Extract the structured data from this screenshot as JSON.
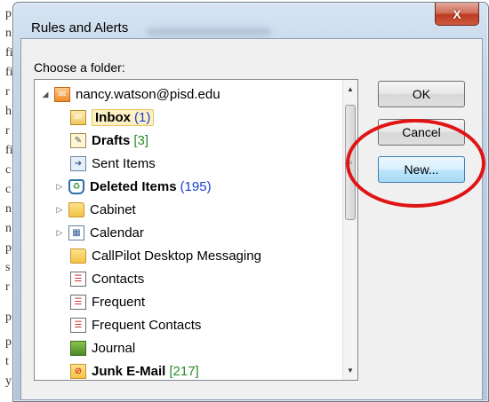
{
  "dialog": {
    "title": "Rules and Alerts",
    "close_label": "X",
    "choose_label": "Choose a folder:"
  },
  "tree": {
    "items": [
      {
        "label": "nancy.watson@pisd.edu",
        "count": "",
        "icon": "mailbox-icon",
        "expander": "◢",
        "bold": false
      },
      {
        "label": "Inbox",
        "count": "(1)",
        "icon": "inbox-icon",
        "expander": "",
        "bold": true
      },
      {
        "label": "Drafts",
        "count": "[3]",
        "icon": "drafts-icon",
        "expander": "",
        "bold": true
      },
      {
        "label": "Sent Items",
        "count": "",
        "icon": "sent-items-icon",
        "expander": "",
        "bold": false
      },
      {
        "label": "Deleted Items",
        "count": "(195)",
        "icon": "deleted-items-icon",
        "expander": "▷",
        "bold": true
      },
      {
        "label": "Cabinet",
        "count": "",
        "icon": "folder-icon",
        "expander": "▷",
        "bold": false
      },
      {
        "label": "Calendar",
        "count": "",
        "icon": "calendar-icon",
        "expander": "▷",
        "bold": false
      },
      {
        "label": "CallPilot Desktop Messaging",
        "count": "",
        "icon": "folder-icon",
        "expander": "",
        "bold": false
      },
      {
        "label": "Contacts",
        "count": "",
        "icon": "contacts-icon",
        "expander": "",
        "bold": false
      },
      {
        "label": "Frequent",
        "count": "",
        "icon": "contacts-icon",
        "expander": "",
        "bold": false
      },
      {
        "label": "Frequent Contacts",
        "count": "",
        "icon": "contacts-icon",
        "expander": "",
        "bold": false
      },
      {
        "label": "Journal",
        "count": "",
        "icon": "journal-icon",
        "expander": "",
        "bold": false
      },
      {
        "label": "Junk E-Mail",
        "count": "[217]",
        "icon": "junk-email-icon",
        "expander": "",
        "bold": true
      }
    ]
  },
  "buttons": {
    "ok": "OK",
    "cancel": "Cancel",
    "new": "New..."
  },
  "colors": {
    "highlight_ring": "#e01414",
    "count_blue": "#1b3fd0",
    "count_green": "#2a8a2a"
  }
}
